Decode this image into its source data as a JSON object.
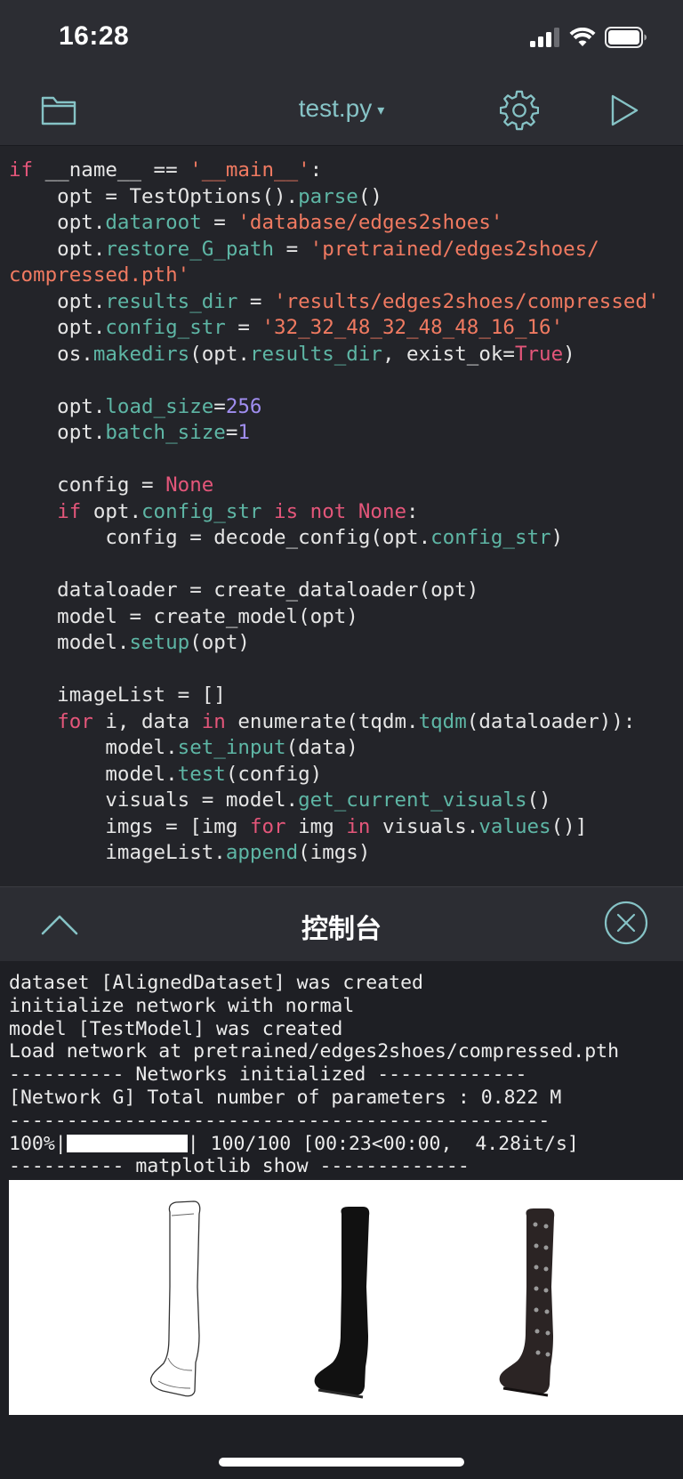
{
  "status": {
    "time": "16:28"
  },
  "nav": {
    "file_name": "test.py",
    "caret": "▾"
  },
  "editor": {
    "lines": [
      [
        {
          "t": "if",
          "c": "kw"
        },
        {
          "t": " __name__ == "
        },
        {
          "t": "'__main__'",
          "c": "str"
        },
        {
          "t": ":"
        }
      ],
      [
        {
          "t": "    opt = TestOptions()."
        },
        {
          "t": "parse",
          "c": "attr"
        },
        {
          "t": "()"
        }
      ],
      [
        {
          "t": "    opt."
        },
        {
          "t": "dataroot",
          "c": "attr"
        },
        {
          "t": " = "
        },
        {
          "t": "'database/edges2shoes'",
          "c": "str"
        }
      ],
      [
        {
          "t": "    opt."
        },
        {
          "t": "restore_G_path",
          "c": "attr"
        },
        {
          "t": " = "
        },
        {
          "t": "'pretrained/edges2shoes/",
          "c": "str"
        }
      ],
      [
        {
          "t": "compressed.pth'",
          "c": "str"
        }
      ],
      [
        {
          "t": "    opt."
        },
        {
          "t": "results_dir",
          "c": "attr"
        },
        {
          "t": " = "
        },
        {
          "t": "'results/edges2shoes/compressed'",
          "c": "str"
        }
      ],
      [
        {
          "t": "    opt."
        },
        {
          "t": "config_str",
          "c": "attr"
        },
        {
          "t": " = "
        },
        {
          "t": "'32_32_48_32_48_48_16_16'",
          "c": "str"
        }
      ],
      [
        {
          "t": "    os."
        },
        {
          "t": "makedirs",
          "c": "attr"
        },
        {
          "t": "(opt."
        },
        {
          "t": "results_dir",
          "c": "attr"
        },
        {
          "t": ", exist_ok="
        },
        {
          "t": "True",
          "c": "kw"
        },
        {
          "t": ")"
        }
      ],
      [],
      [
        {
          "t": "    opt."
        },
        {
          "t": "load_size",
          "c": "attr"
        },
        {
          "t": "="
        },
        {
          "t": "256",
          "c": "num"
        }
      ],
      [
        {
          "t": "    opt."
        },
        {
          "t": "batch_size",
          "c": "attr"
        },
        {
          "t": "="
        },
        {
          "t": "1",
          "c": "num"
        }
      ],
      [],
      [
        {
          "t": "    config = "
        },
        {
          "t": "None",
          "c": "kw"
        }
      ],
      [
        {
          "t": "    "
        },
        {
          "t": "if",
          "c": "kw"
        },
        {
          "t": " opt."
        },
        {
          "t": "config_str",
          "c": "attr"
        },
        {
          "t": " "
        },
        {
          "t": "is not None",
          "c": "kw"
        },
        {
          "t": ":"
        }
      ],
      [
        {
          "t": "        config = decode_config(opt."
        },
        {
          "t": "config_str",
          "c": "attr"
        },
        {
          "t": ")"
        }
      ],
      [],
      [
        {
          "t": "    dataloader = create_dataloader(opt)"
        }
      ],
      [
        {
          "t": "    model = create_model(opt)"
        }
      ],
      [
        {
          "t": "    model."
        },
        {
          "t": "setup",
          "c": "attr"
        },
        {
          "t": "(opt)"
        }
      ],
      [],
      [
        {
          "t": "    imageList = []"
        }
      ],
      [
        {
          "t": "    "
        },
        {
          "t": "for",
          "c": "kw"
        },
        {
          "t": " i, data "
        },
        {
          "t": "in",
          "c": "kw"
        },
        {
          "t": " enumerate(tqdm."
        },
        {
          "t": "tqdm",
          "c": "attr"
        },
        {
          "t": "(dataloader)):"
        }
      ],
      [
        {
          "t": "        model."
        },
        {
          "t": "set_input",
          "c": "attr"
        },
        {
          "t": "(data)"
        }
      ],
      [
        {
          "t": "        model."
        },
        {
          "t": "test",
          "c": "attr"
        },
        {
          "t": "(config)"
        }
      ],
      [
        {
          "t": "        visuals = model."
        },
        {
          "t": "get_current_visuals",
          "c": "attr"
        },
        {
          "t": "()"
        }
      ],
      [
        {
          "t": "        imgs = [img "
        },
        {
          "t": "for",
          "c": "kw"
        },
        {
          "t": " img "
        },
        {
          "t": "in",
          "c": "kw"
        },
        {
          "t": " visuals."
        },
        {
          "t": "values",
          "c": "attr"
        },
        {
          "t": "()]"
        }
      ],
      [
        {
          "t": "        imageList."
        },
        {
          "t": "append",
          "c": "attr"
        },
        {
          "t": "(imgs)"
        }
      ]
    ]
  },
  "console": {
    "title": "控制台",
    "lines": [
      "dataset [AlignedDataset] was created",
      "initialize network with normal",
      "model [TestModel] was created",
      "Load network at pretrained/edges2shoes/compressed.pth",
      "---------- Networks initialized -------------",
      "[Network G] Total number of parameters : 0.822 M",
      "-----------------------------------------------"
    ],
    "progress": {
      "percent_text": "100%|",
      "fraction": 1.0,
      "rest": "| 100/100 [00:23<00:00,  4.28it/s]"
    },
    "after_lines": [
      "---------- matplotlib show -------------"
    ]
  },
  "colors": {
    "accent": "#86c3c6",
    "keyword": "#e4567a",
    "string": "#f07a61",
    "attribute": "#5eb6a5",
    "number": "#a08ef0"
  }
}
